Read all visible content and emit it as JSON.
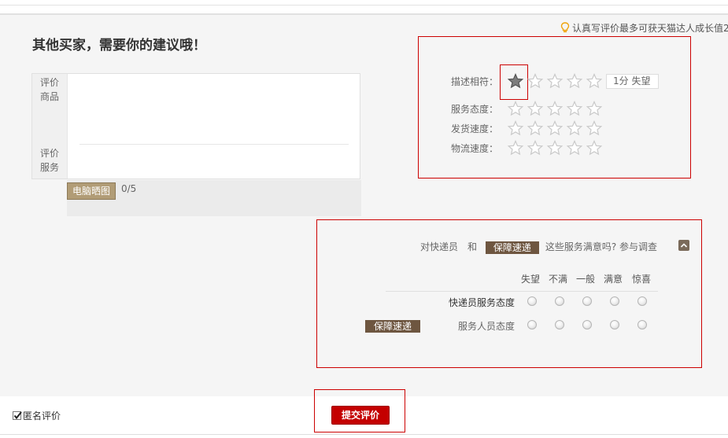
{
  "hint": {
    "text": "认真写评价最多可获天猫达人成长值2",
    "icon": "lightbulb-icon",
    "icon_color": "#f0a30a"
  },
  "review": {
    "heading": "其他买家，需要你的建议哦！",
    "product_label": "评价商品",
    "service_label": "评价服务",
    "upload_button": "电脑晒图",
    "upload_count": "0/5"
  },
  "ratings": {
    "rows": [
      {
        "label": "描述相符：",
        "value": 1
      },
      {
        "label": "服务态度：",
        "value": 0
      },
      {
        "label": "发货速度：",
        "value": 0
      },
      {
        "label": "物流速度：",
        "value": 0
      }
    ],
    "max": 5,
    "score_tag": "1分  失望",
    "star_icon": "star-icon"
  },
  "survey": {
    "intro_prefix": "对快递员　和",
    "service_tag": "保障速递",
    "intro_suffix": "这些服务满意吗? 参与调查",
    "collapse_icon": "chevron-up-icon",
    "columns": [
      "失望",
      "不满",
      "一般",
      "满意",
      "惊喜"
    ],
    "questions": [
      {
        "label": "快递员服务态度"
      },
      {
        "label": "服务人员态度"
      }
    ],
    "row_tag": "保障速递"
  },
  "footer": {
    "anonymous_label": "匿名评价",
    "anonymous_checked": true,
    "submit_label": "提交评价"
  },
  "colors": {
    "accent_red": "#c40000",
    "brown_tag": "#6e5640",
    "upload_button": "#b19c76",
    "annotation_box": "#cc0000"
  }
}
